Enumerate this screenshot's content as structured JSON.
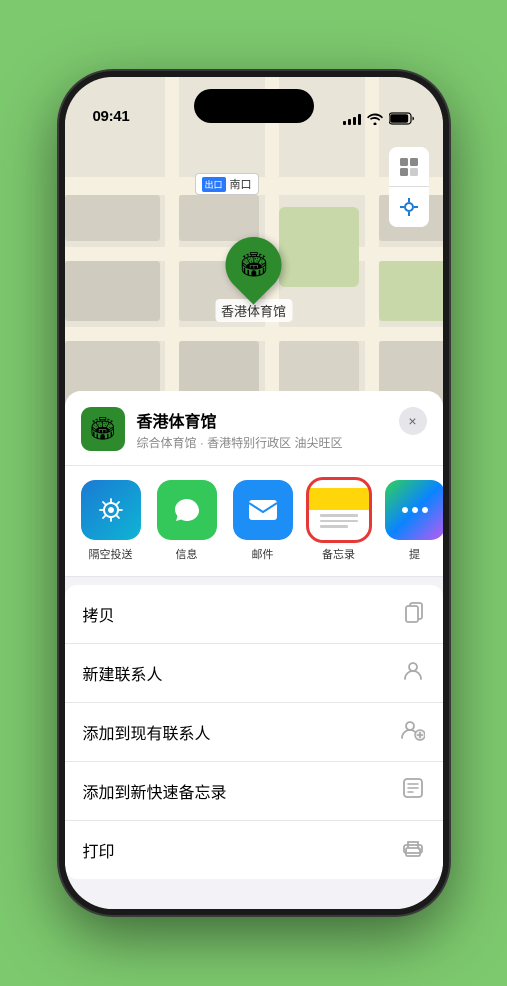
{
  "status_bar": {
    "time": "09:41",
    "location_arrow": "▲"
  },
  "map": {
    "label_badge": "出口",
    "label_text": "南口",
    "pin_emoji": "🏟",
    "pin_label": "香港体育馆"
  },
  "place_header": {
    "name": "香港体育馆",
    "subtitle": "综合体育馆 · 香港特别行政区 油尖旺区",
    "close_label": "×"
  },
  "share_items": [
    {
      "id": "airdrop",
      "label": "隔空投送"
    },
    {
      "id": "messages",
      "label": "信息"
    },
    {
      "id": "mail",
      "label": "邮件"
    },
    {
      "id": "notes",
      "label": "备忘录"
    },
    {
      "id": "more",
      "label": "提"
    }
  ],
  "actions": [
    {
      "label": "拷贝",
      "icon": "📋"
    },
    {
      "label": "新建联系人",
      "icon": "👤"
    },
    {
      "label": "添加到现有联系人",
      "icon": "👤"
    },
    {
      "label": "添加到新快速备忘录",
      "icon": "📝"
    },
    {
      "label": "打印",
      "icon": "🖨"
    }
  ]
}
